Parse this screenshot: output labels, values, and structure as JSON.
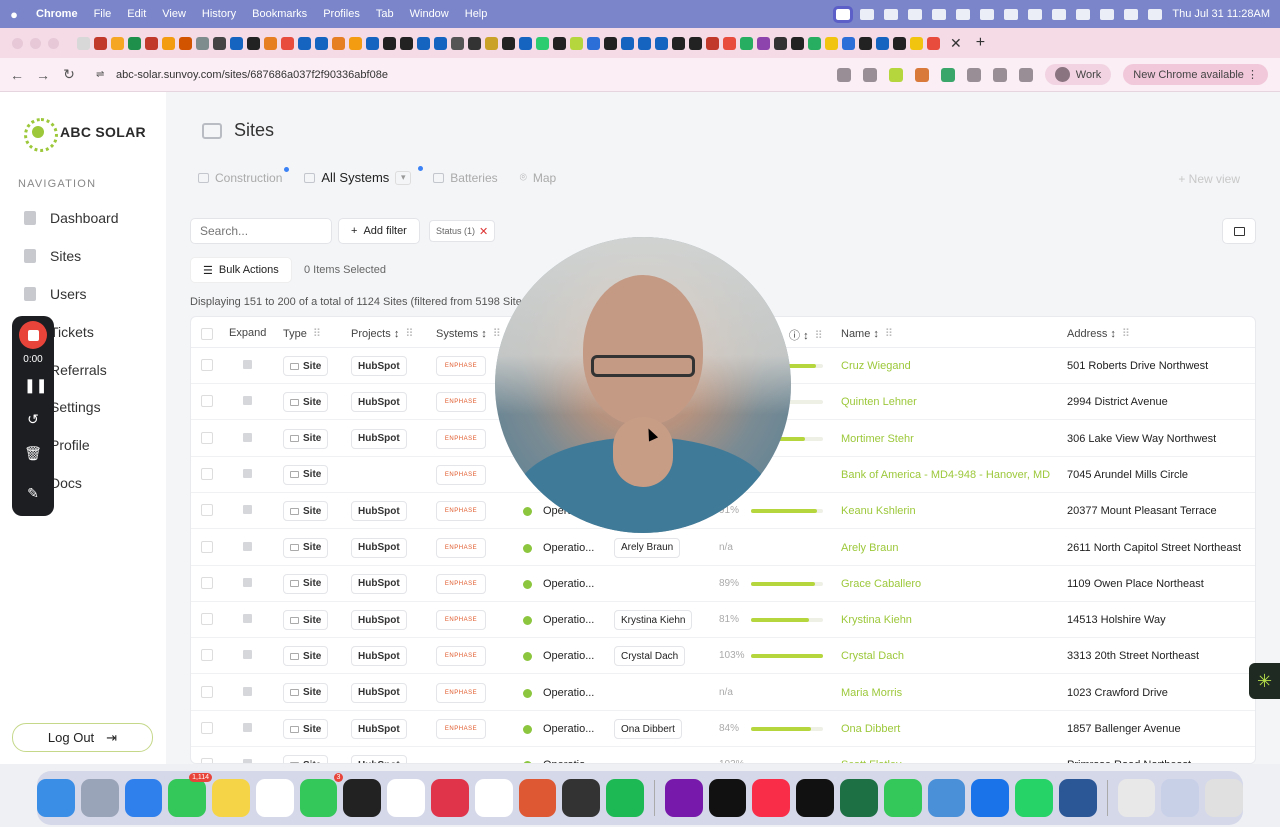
{
  "menubar": {
    "apple": "",
    "app": "Chrome",
    "items": [
      "File",
      "Edit",
      "View",
      "History",
      "Bookmarks",
      "Profiles",
      "Tab",
      "Window",
      "Help"
    ],
    "clock": "Thu Jul 31  11:28AM"
  },
  "browser": {
    "url": "abc-solar.sunvoy.com/sites/687686a037f2f90336abf08e",
    "profile": "Work",
    "update_label": "New Chrome available"
  },
  "sidebar": {
    "brand": "ABC SOLAR",
    "nav_heading": "NAVIGATION",
    "items": [
      {
        "label": "Dashboard"
      },
      {
        "label": "Sites"
      },
      {
        "label": "Users"
      },
      {
        "label": "Tickets"
      },
      {
        "label": "Referrals"
      },
      {
        "label": "Settings"
      },
      {
        "label": "Profile"
      },
      {
        "label": "Docs"
      }
    ],
    "logout_label": "Log Out"
  },
  "recorder": {
    "time": "0:00"
  },
  "page": {
    "title": "Sites",
    "views": [
      "Construction",
      "All Systems",
      "Batteries",
      "Map"
    ],
    "new_view": "+ New view",
    "search_placeholder": "Search...",
    "add_filter": "Add filter",
    "status_filter": "Status (1)",
    "bulk_actions": "Bulk Actions",
    "selected": "0 Items Selected",
    "displaying": "Displaying 151 to 200 of a total of 1124 Sites (filtered from 5198 Sites)"
  },
  "table": {
    "columns": [
      "Expand",
      "Type",
      "Projects",
      "Systems",
      "Name",
      "Address"
    ],
    "rows": [
      {
        "type": "Site",
        "project": "HubSpot",
        "system": "ENPHASE",
        "status": "",
        "person": "",
        "pct": "",
        "bar": 0.9,
        "name": "Cruz Wiegand",
        "address": "501 Roberts Drive Northwest"
      },
      {
        "type": "Site",
        "project": "HubSpot",
        "system": "ENPHASE",
        "status": "",
        "person": "",
        "pct": "",
        "bar": 0.5,
        "name": "Quinten Lehner",
        "address": "2994 District Avenue"
      },
      {
        "type": "Site",
        "project": "HubSpot",
        "system": "ENPHASE",
        "status": "",
        "person": "",
        "pct": "",
        "bar": 0.75,
        "name": "Mortimer Stehr",
        "address": "306 Lake View Way Northwest"
      },
      {
        "type": "Site",
        "project": "",
        "system": "ENPHASE",
        "status": "",
        "person": "",
        "pct": "",
        "bar": null,
        "name": "Bank of America - MD4-948 - Hanover, MD",
        "address": "7045 Arundel Mills Circle"
      },
      {
        "type": "Site",
        "project": "HubSpot",
        "system": "ENPHASE",
        "status": "Operatio...",
        "person": "",
        "pct": "91%",
        "bar": 0.91,
        "name": "Keanu Kshlerin",
        "address": "20377 Mount Pleasant Terrace"
      },
      {
        "type": "Site",
        "project": "HubSpot",
        "system": "ENPHASE",
        "status": "Operatio...",
        "person": "Arely Braun",
        "pct": "n/a",
        "bar": null,
        "name": "Arely Braun",
        "address": "2611 North Capitol Street Northeast"
      },
      {
        "type": "Site",
        "project": "HubSpot",
        "system": "ENPHASE",
        "status": "Operatio...",
        "person": "",
        "pct": "89%",
        "bar": 0.89,
        "name": "Grace Caballero",
        "address": "1109 Owen Place Northeast"
      },
      {
        "type": "Site",
        "project": "HubSpot",
        "system": "ENPHASE",
        "status": "Operatio...",
        "person": "Krystina Kiehn",
        "pct": "81%",
        "bar": 0.81,
        "name": "Krystina Kiehn",
        "address": "14513 Holshire Way"
      },
      {
        "type": "Site",
        "project": "HubSpot",
        "system": "ENPHASE",
        "status": "Operatio...",
        "person": "Crystal Dach",
        "pct": "103%",
        "bar": 1.0,
        "name": "Crystal Dach",
        "address": "3313 20th Street Northeast"
      },
      {
        "type": "Site",
        "project": "HubSpot",
        "system": "ENPHASE",
        "status": "Operatio...",
        "person": "",
        "pct": "n/a",
        "bar": null,
        "name": "Maria Morris",
        "address": "1023 Crawford Drive"
      },
      {
        "type": "Site",
        "project": "HubSpot",
        "system": "ENPHASE",
        "status": "Operatio...",
        "person": "Ona Dibbert",
        "pct": "84%",
        "bar": 0.84,
        "name": "Ona Dibbert",
        "address": "1857 Ballenger Avenue"
      },
      {
        "type": "Site",
        "project": "HubSpot",
        "system": "",
        "status": "Operatio...",
        "person": "",
        "pct": "103%",
        "bar": 1.0,
        "name": "Scott Flatley",
        "address": "Primrose Road Northeast"
      }
    ]
  },
  "dock": {
    "badges": {
      "messages": "1,114",
      "facetime": "3"
    }
  },
  "colors": {
    "accent": "#9cc83a",
    "record": "#e8443a",
    "hubspot": "#ff7a59",
    "enphase": "#e05a2b"
  }
}
